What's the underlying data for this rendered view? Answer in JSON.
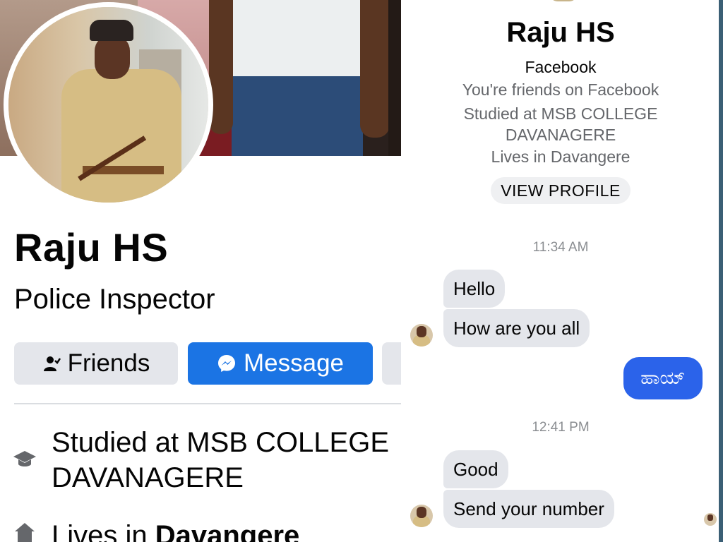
{
  "profile": {
    "name": "Raju HS",
    "job": "Police Inspector",
    "friends_button": "Friends",
    "message_button": "Message",
    "studied": "Studied at MSB COLLEGE DAVANAGERE",
    "lives_prefix": "Lives in ",
    "lives_place": "Davangere",
    "icons": {
      "friends": "person-check-icon",
      "message": "messenger-icon",
      "studied": "graduation-cap-icon",
      "lives": "home-icon"
    }
  },
  "chat": {
    "name": "Raju HS",
    "platform": "Facebook",
    "friends_note": "You're friends on Facebook",
    "studied": "Studied at MSB COLLEGE DAVANAGERE",
    "lives": "Lives in Davangere",
    "view_profile": "VIEW PROFILE",
    "messages": [
      {
        "time": "11:34 AM"
      },
      {
        "from": "them",
        "text": "Hello"
      },
      {
        "from": "them",
        "text": "How are you all"
      },
      {
        "from": "me",
        "text": "ಹಾಯ್"
      },
      {
        "time": "12:41 PM"
      },
      {
        "from": "them",
        "text": "Good"
      },
      {
        "from": "them",
        "text": "Send your number"
      }
    ]
  },
  "colors": {
    "accent": "#1b74e4",
    "sent_bubble": "#2b63ea",
    "received_bubble": "#e4e6eb",
    "secondary_button": "#e4e6eb",
    "muted_text": "#65676b"
  }
}
